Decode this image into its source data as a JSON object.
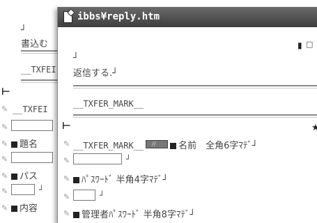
{
  "background_doc": {
    "line_end_1": "┘",
    "label_1": "書込む",
    "txfer_1": "__TXFEI",
    "txfer_2": "__TXFEI",
    "label_name": "題名",
    "label_pass": "パス",
    "label_content": "内容",
    "small_end": "┘"
  },
  "window": {
    "title": "ibbs¥reply.htm",
    "line_end": "┘",
    "reply_label": "返信する.┘",
    "txfer_mark": "__TXFER_MARK__",
    "flag_text": "□",
    "row_name": {
      "prefix": "__TXFER_MARK__",
      "text": "名前　全角6字ﾏﾃﾞ┘"
    },
    "field_end": "┘",
    "row_password": "ﾊﾟｽﾜｰﾄﾞ 半角4字ﾏﾃﾞ┘",
    "field_end_2": "┘",
    "row_admin_password": "管理者ﾊﾟｽﾜｰﾄﾞ 半角8字ﾏﾃﾞ┘"
  }
}
